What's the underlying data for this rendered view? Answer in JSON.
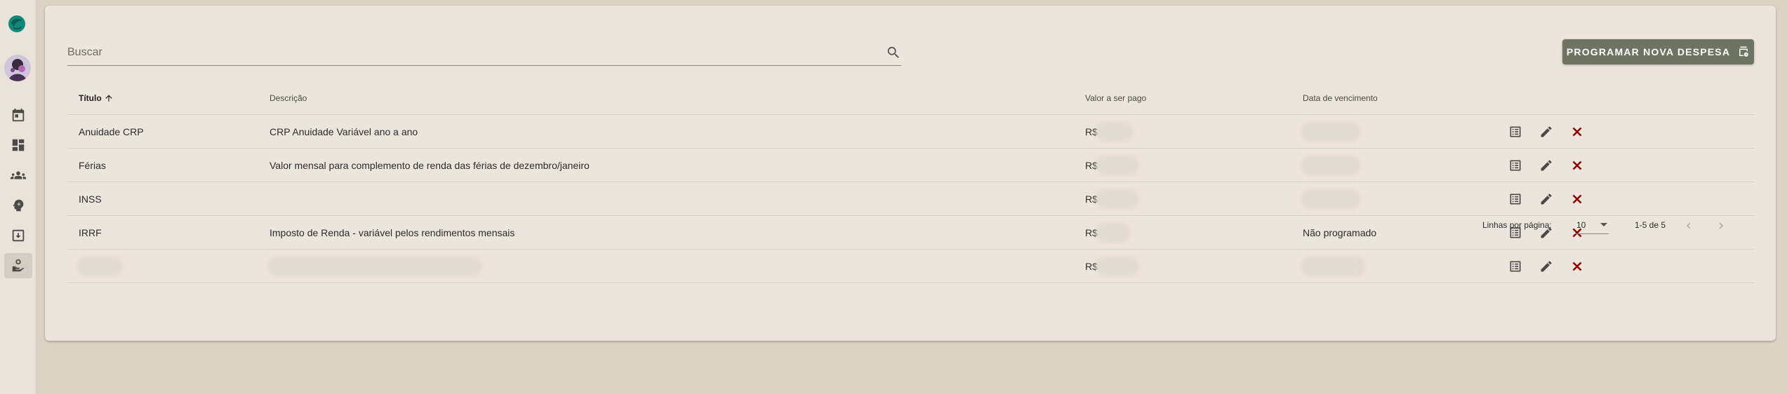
{
  "sidebar": {
    "items": [
      {
        "icon": "calendar-icon"
      },
      {
        "icon": "dashboard-icon"
      },
      {
        "icon": "groups-icon"
      },
      {
        "icon": "psychology-icon"
      },
      {
        "icon": "export-icon"
      },
      {
        "icon": "payments-icon",
        "active": true
      }
    ]
  },
  "search": {
    "placeholder": "Buscar"
  },
  "toolbar": {
    "program_label": "PROGRAMAR NOVA DESPESA"
  },
  "table": {
    "headers": {
      "title": "Título",
      "description": "Descrição",
      "value": "Valor a ser pago",
      "due_date": "Data de vencimento"
    },
    "rows": [
      {
        "title": "Anuidade CRP",
        "description": "CRP Anuidade Variável ano a ano",
        "currency": "R$",
        "due_date": ""
      },
      {
        "title": "Férias",
        "description": "Valor mensal para complemento de renda das férias de dezembro/janeiro",
        "currency": "R$",
        "due_date": ""
      },
      {
        "title": "INSS",
        "description": "",
        "currency": "R$",
        "due_date": ""
      },
      {
        "title": "IRRF",
        "description": "Imposto de Renda - variável pelos rendimentos mensais",
        "currency": "R$",
        "due_date": "Não programado"
      },
      {
        "title": "",
        "description": "",
        "currency": "R$",
        "due_date": ""
      }
    ]
  },
  "pagination": {
    "rows_label": "Linhas por página:",
    "rows_value": "10",
    "range": "1-5 de 5"
  },
  "colors": {
    "accent": "#6e7461",
    "delete": "#8b0000",
    "background": "#dbd3c3",
    "card": "#ece5dd"
  }
}
